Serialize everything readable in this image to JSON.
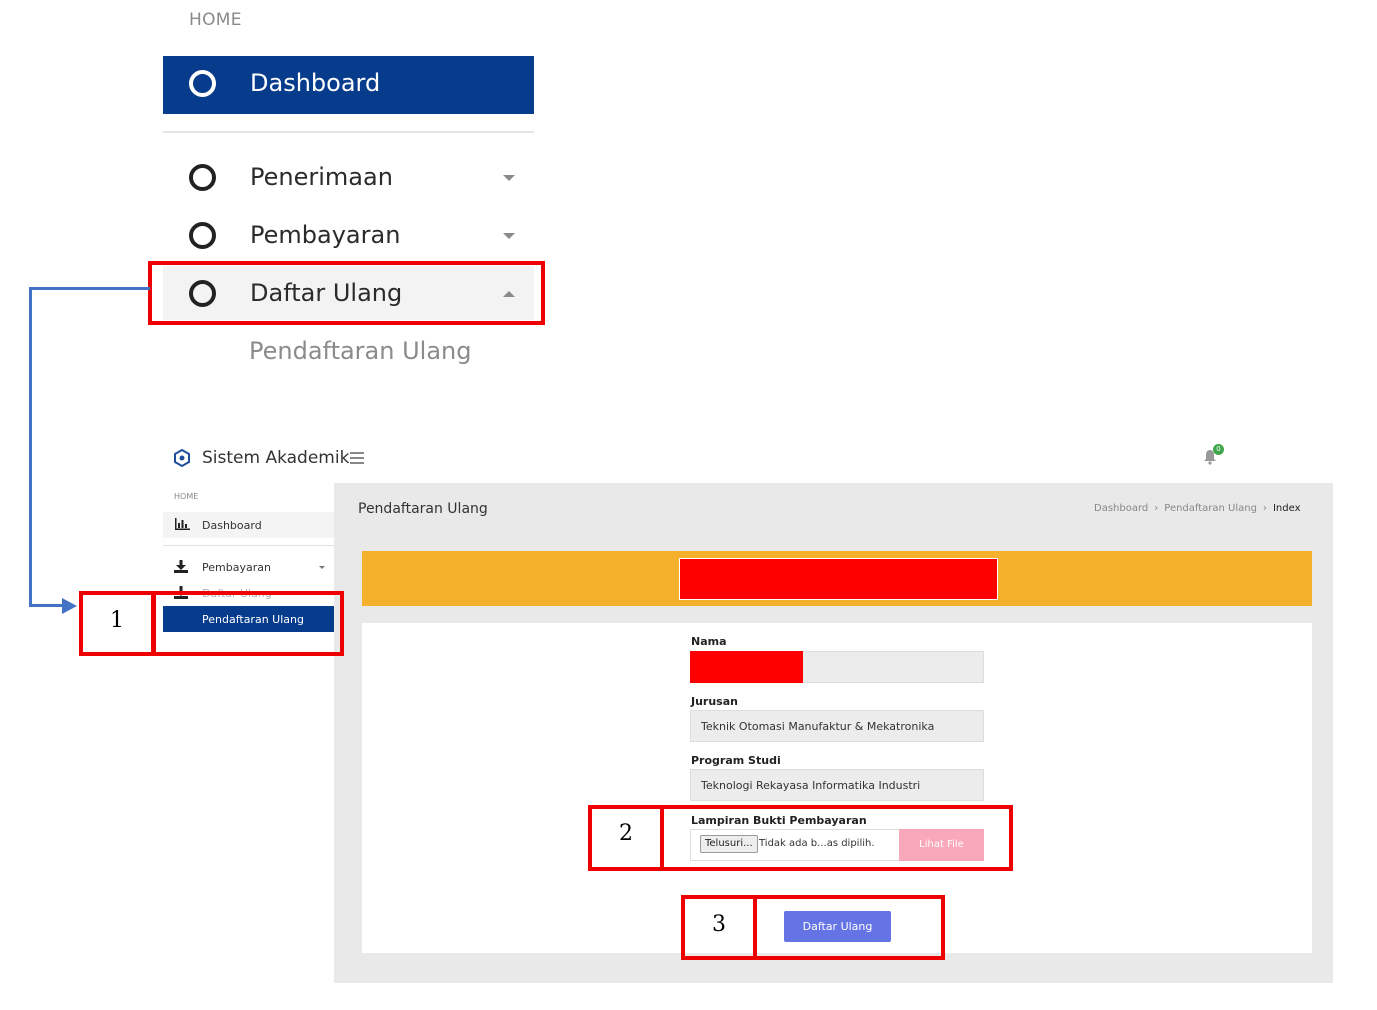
{
  "zoom_menu": {
    "home_label": "HOME",
    "dashboard_label": "Dashboard",
    "items": [
      {
        "label": "Penerimaan"
      },
      {
        "label": "Pembayaran"
      },
      {
        "label": "Daftar Ulang"
      }
    ],
    "sub_item": "Pendaftaran Ulang"
  },
  "app": {
    "brand": "Sistem Akademik",
    "notification_count": "0"
  },
  "sidebar": {
    "home_label": "HOME",
    "dashboard_label": "Dashboard",
    "items": [
      {
        "label": "Pembayaran"
      },
      {
        "label": "Daftar Ulang"
      }
    ],
    "active_label": "Pendaftaran Ulang"
  },
  "page": {
    "title": "Pendaftaran Ulang",
    "breadcrumb": [
      "Dashboard",
      "Pendaftaran Ulang",
      "Index"
    ]
  },
  "form": {
    "nama_label": "Nama",
    "jurusan_label": "Jurusan",
    "jurusan_value": "Teknik Otomasi Manufaktur & Mekatronika",
    "prodi_label": "Program Studi",
    "prodi_value": "Teknologi Rekayasa Informatika Industri",
    "lampiran_label": "Lampiran Bukti Pembayaran",
    "browse_label": "Telusuri...",
    "file_status": "Tidak ada b...as dipilih.",
    "view_file_label": "Lihat File",
    "submit_label": "Daftar Ulang"
  },
  "annotations": [
    "1",
    "2",
    "3"
  ],
  "colors": {
    "primary": "#073c8c",
    "banner": "#f6b12c",
    "highlight": "#ee0000",
    "submit": "#6474e4",
    "arrow": "#4472c4"
  }
}
